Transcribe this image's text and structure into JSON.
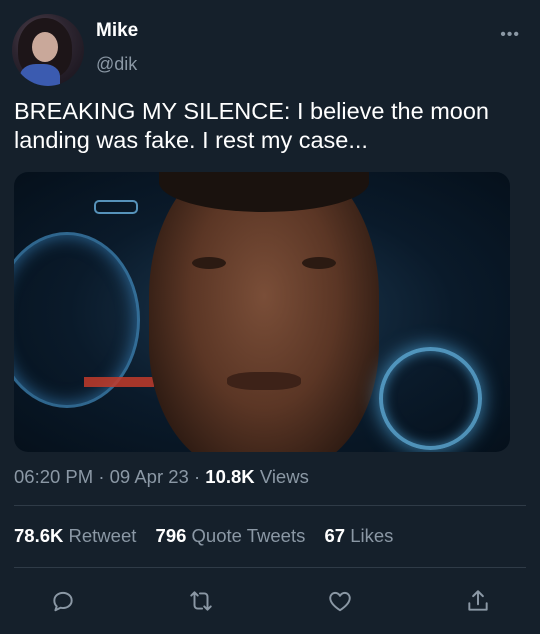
{
  "author": {
    "name": "Mike",
    "handle": "@dik"
  },
  "tweet": {
    "text": "BREAKING MY SILENCE: I believe the moon landing was fake. I rest my case...",
    "media_description_icon": "photo"
  },
  "meta": {
    "time": "06:20 PM",
    "sep1": " · ",
    "date": "09 Apr 23",
    "sep2": " · ",
    "views_count": "10.8K",
    "views_label": "Views"
  },
  "stats": {
    "retweets_count": "78.6K",
    "retweets_label": "Retweet",
    "quotes_count": "796",
    "quotes_label": "Quote Tweets",
    "likes_count": "67",
    "likes_label": "Likes"
  },
  "actions": [
    "reply-icon",
    "retweet-icon",
    "like-icon",
    "share-icon"
  ],
  "colors": {
    "background": "#15202b",
    "secondary_text": "#8b98a5",
    "divider": "#2f3b47"
  }
}
